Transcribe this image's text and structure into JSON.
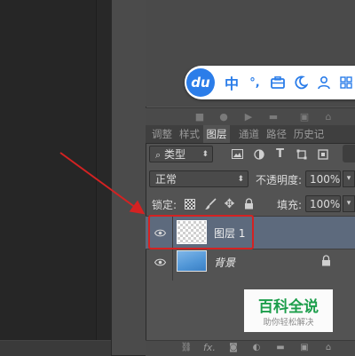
{
  "ime_bar": {
    "logo": "du",
    "mode_label": "中",
    "punct_label": "°,",
    "icons": [
      "toolbox-icon",
      "moon-icon",
      "user-icon"
    ]
  },
  "tabs": [
    {
      "label": "调整",
      "active": false
    },
    {
      "label": "样式",
      "active": false
    },
    {
      "label": "图层",
      "active": true
    },
    {
      "label": "通道",
      "active": false
    },
    {
      "label": "路径",
      "active": false
    },
    {
      "label": "历史记",
      "active": false
    }
  ],
  "filter": {
    "kind_label": "类型"
  },
  "blend": {
    "mode": "正常",
    "opacity_label": "不透明度:",
    "opacity_value": "100%"
  },
  "lock": {
    "label": "锁定:",
    "fill_label": "填充:",
    "fill_value": "100%"
  },
  "layers": [
    {
      "name": "图层 1",
      "selected": true,
      "thumb": "transparent"
    },
    {
      "name": "背景",
      "selected": false,
      "thumb": "sky",
      "locked": true
    }
  ],
  "watermark": {
    "title": "百科全说",
    "subtitle": "助你轻松解决"
  },
  "colors": {
    "annotation": "#d42222",
    "selection": "#5d6a7d",
    "ime_accent": "#2b7de9",
    "watermark_green": "#1c9e4b"
  }
}
